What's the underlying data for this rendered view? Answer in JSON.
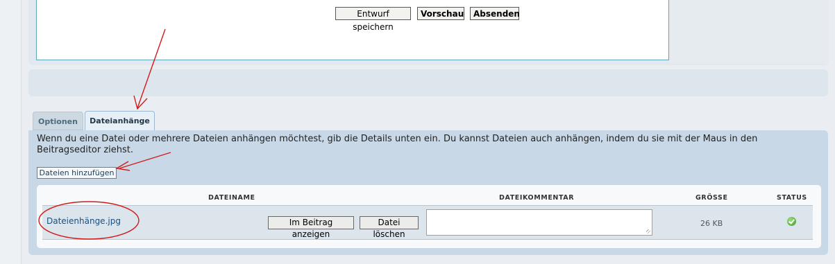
{
  "toolbar": {
    "save_draft_label": "Entwurf speichern",
    "preview_label": "Vorschau",
    "submit_label": "Absenden"
  },
  "tabs": [
    {
      "label": "Optionen"
    },
    {
      "label": "Dateianhänge"
    }
  ],
  "attachments": {
    "description": "Wenn du eine Datei oder mehrere Dateien anhängen möchtest, gib die Details unten ein. Du kannst Dateien auch anhängen, indem du sie mit der Maus in den Beitragseditor ziehst.",
    "add_button_label": "Dateien hinzufügen",
    "columns": [
      "DATEINAME",
      "DATEIKOMMENTAR",
      "GRÖSSE",
      "STATUS"
    ],
    "rows": [
      {
        "filename": "Dateienhänge.jpg",
        "show_in_post_label": "Im Beitrag anzeigen",
        "delete_label": "Datei löschen",
        "comment": "",
        "size": "26 KB",
        "status_icon": "check-circle-icon"
      }
    ]
  },
  "colors": {
    "annotation": "#d11b1b",
    "status_ok": "#3d9a25"
  }
}
